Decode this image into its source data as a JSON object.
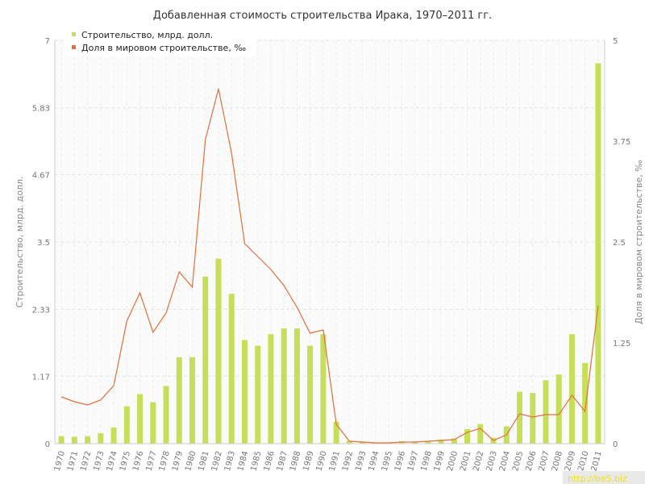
{
  "chart_data": {
    "type": "bar+line",
    "title": "Добавленная стоимость строительства Ирака, 1970–2011 гг.",
    "categories": [
      "1970",
      "1971",
      "1972",
      "1973",
      "1974",
      "1975",
      "1976",
      "1977",
      "1978",
      "1979",
      "1980",
      "1981",
      "1982",
      "1983",
      "1984",
      "1985",
      "1986",
      "1987",
      "1988",
      "1989",
      "1990",
      "1991",
      "1992",
      "1993",
      "1994",
      "1995",
      "1996",
      "1997",
      "1998",
      "1999",
      "2000",
      "2001",
      "2002",
      "2003",
      "2004",
      "2005",
      "2006",
      "2007",
      "2008",
      "2009",
      "2010",
      "2011"
    ],
    "series": [
      {
        "name": "Строительство, млрд. долл.",
        "type": "bar",
        "axis": "left",
        "color": "#c5df5a",
        "values": [
          0.13,
          0.12,
          0.13,
          0.18,
          0.28,
          0.65,
          0.86,
          0.72,
          1.0,
          1.5,
          1.5,
          2.9,
          3.21,
          2.6,
          1.8,
          1.7,
          1.9,
          2.0,
          2.0,
          1.7,
          1.9,
          0.38,
          0.05,
          0.03,
          0.02,
          0.02,
          0.04,
          0.03,
          0.04,
          0.07,
          0.09,
          0.25,
          0.34,
          0.1,
          0.3,
          0.9,
          0.88,
          1.1,
          1.2,
          1.9,
          1.4,
          6.6
        ]
      },
      {
        "name": "Доля в мировом строительстве, ‰",
        "type": "line",
        "axis": "right",
        "color": "#e0703a",
        "values": [
          0.58,
          0.52,
          0.48,
          0.54,
          0.72,
          1.52,
          1.87,
          1.38,
          1.62,
          2.13,
          1.94,
          3.77,
          4.4,
          3.6,
          2.48,
          2.32,
          2.16,
          1.96,
          1.69,
          1.37,
          1.41,
          0.24,
          0.03,
          0.02,
          0.01,
          0.01,
          0.02,
          0.02,
          0.03,
          0.04,
          0.05,
          0.14,
          0.19,
          0.04,
          0.11,
          0.37,
          0.33,
          0.36,
          0.36,
          0.6,
          0.4,
          1.71
        ]
      }
    ],
    "ylabel": "Строительство, млрд. долл.",
    "y2label": "Доля в мировом строительстве, ‰",
    "ylim": [
      0,
      7
    ],
    "y2lim": [
      0,
      5
    ],
    "yticks": [
      "0",
      "1.17",
      "2.33",
      "3.5",
      "4.67",
      "5.83",
      "7"
    ],
    "y2ticks": [
      "0",
      "1.25",
      "2.5",
      "3.75",
      "5"
    ],
    "grid": true,
    "legend_position": "top-left"
  },
  "watermark": "http://be5.biz"
}
